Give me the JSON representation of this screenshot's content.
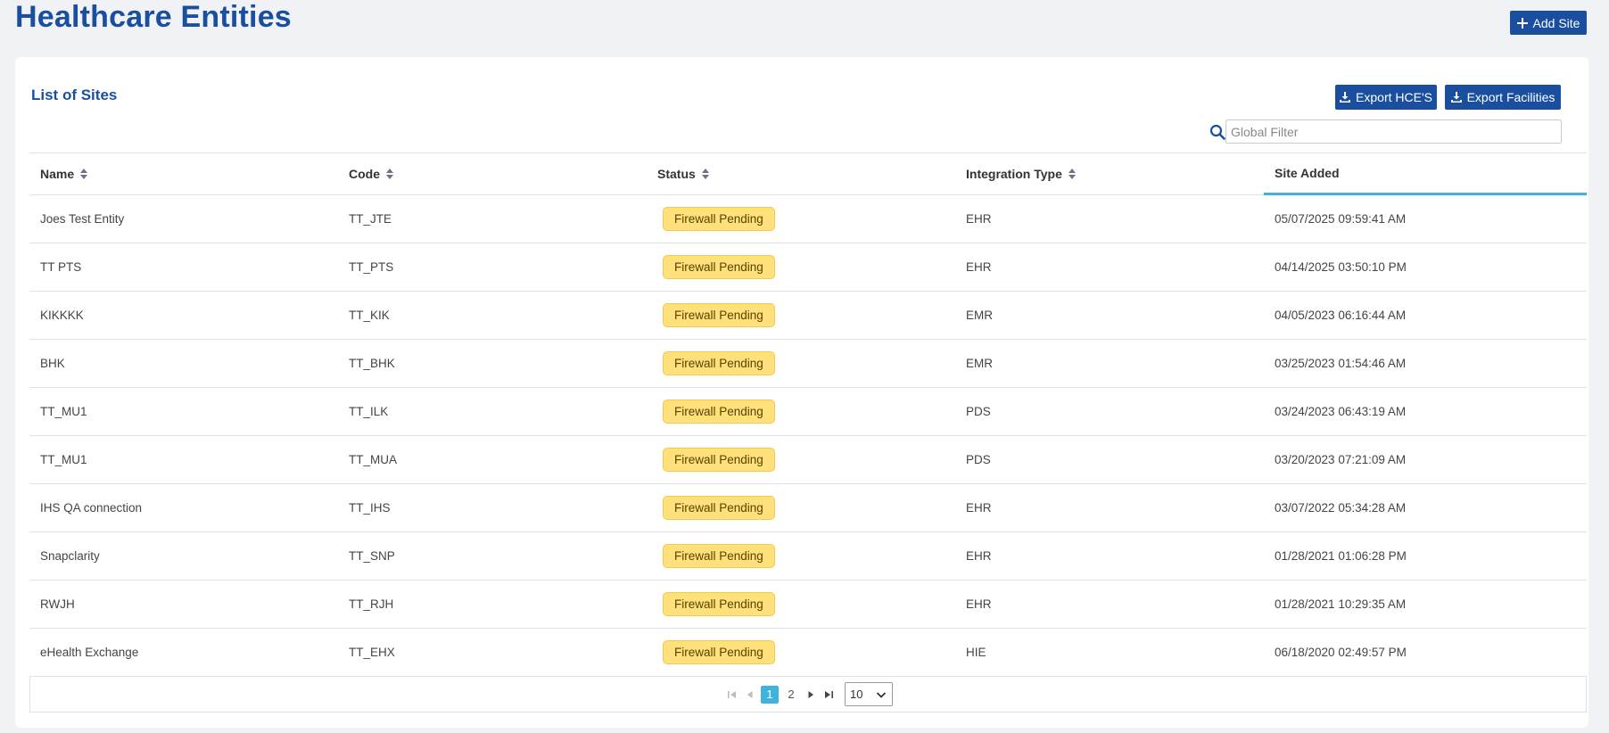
{
  "header": {
    "title": "Healthcare Entities",
    "add_site_label": "Add Site"
  },
  "card": {
    "title": "List of Sites",
    "export_hce_label": "Export HCE'S",
    "export_facilities_label": "Export Facilities",
    "filter_placeholder": "Global Filter"
  },
  "table": {
    "columns": [
      "Name",
      "Code",
      "Status",
      "Integration Type",
      "Site Added"
    ],
    "rows": [
      {
        "name": "Joes Test Entity",
        "code": "TT_JTE",
        "status": "Firewall Pending",
        "integration": "EHR",
        "added": "05/07/2025 09:59:41 AM"
      },
      {
        "name": "TT PTS",
        "code": "TT_PTS",
        "status": "Firewall Pending",
        "integration": "EHR",
        "added": "04/14/2025 03:50:10 PM"
      },
      {
        "name": "KIKKKK",
        "code": "TT_KIK",
        "status": "Firewall Pending",
        "integration": "EMR",
        "added": "04/05/2023 06:16:44 AM"
      },
      {
        "name": "BHK",
        "code": "TT_BHK",
        "status": "Firewall Pending",
        "integration": "EMR",
        "added": "03/25/2023 01:54:46 AM"
      },
      {
        "name": "TT_MU1",
        "code": "TT_ILK",
        "status": "Firewall Pending",
        "integration": "PDS",
        "added": "03/24/2023 06:43:19 AM"
      },
      {
        "name": "TT_MU1",
        "code": "TT_MUA",
        "status": "Firewall Pending",
        "integration": "PDS",
        "added": "03/20/2023 07:21:09 AM"
      },
      {
        "name": "IHS QA connection",
        "code": "TT_IHS",
        "status": "Firewall Pending",
        "integration": "EHR",
        "added": "03/07/2022 05:34:28 AM"
      },
      {
        "name": "Snapclarity",
        "code": "TT_SNP",
        "status": "Firewall Pending",
        "integration": "EHR",
        "added": "01/28/2021 01:06:28 PM"
      },
      {
        "name": "RWJH",
        "code": "TT_RJH",
        "status": "Firewall Pending",
        "integration": "EHR",
        "added": "01/28/2021 10:29:35 AM"
      },
      {
        "name": "eHealth Exchange",
        "code": "TT_EHX",
        "status": "Firewall Pending",
        "integration": "HIE",
        "added": "06/18/2020 02:49:57 PM"
      }
    ]
  },
  "paginator": {
    "pages": [
      "1",
      "2"
    ],
    "current_page": "1",
    "rows_per_page": "10"
  },
  "colors": {
    "brand": "#1a4fa0",
    "accent": "#3fb3dd",
    "badge_bg": "#ffe07a"
  }
}
